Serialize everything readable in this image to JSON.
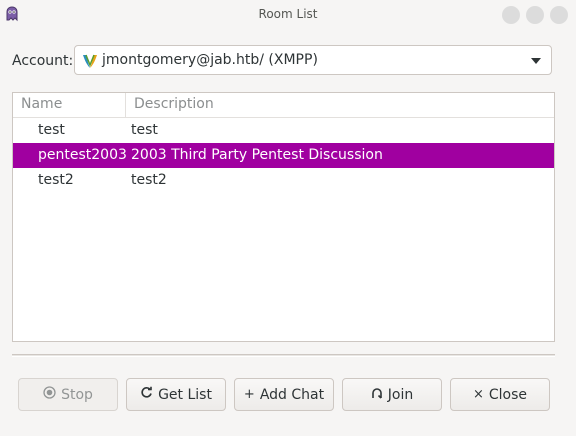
{
  "window": {
    "title": "Room List"
  },
  "account": {
    "label": "Account:",
    "value": "jmontgomery@jab.htb/ (XMPP)"
  },
  "list": {
    "columns": [
      "Name",
      "Description"
    ],
    "rows": [
      {
        "name": "test",
        "description": "test",
        "selected": false
      },
      {
        "name": "pentest2003",
        "description": "2003 Third Party Pentest Discussion",
        "selected": true
      },
      {
        "name": "test2",
        "description": "test2",
        "selected": false
      }
    ]
  },
  "buttons": {
    "stop": {
      "label": "Stop",
      "icon": "stop-icon",
      "enabled": false
    },
    "get_list": {
      "label": "Get List",
      "icon": "refresh-icon",
      "enabled": true
    },
    "add_chat": {
      "label": "Add Chat",
      "icon": "plus-icon",
      "enabled": true
    },
    "join": {
      "label": "Join",
      "icon": "join-icon",
      "enabled": true
    },
    "close": {
      "label": "Close",
      "icon": "close-icon",
      "enabled": true
    }
  },
  "colors": {
    "selection": "#a000a0",
    "background": "#f6f5f4"
  }
}
